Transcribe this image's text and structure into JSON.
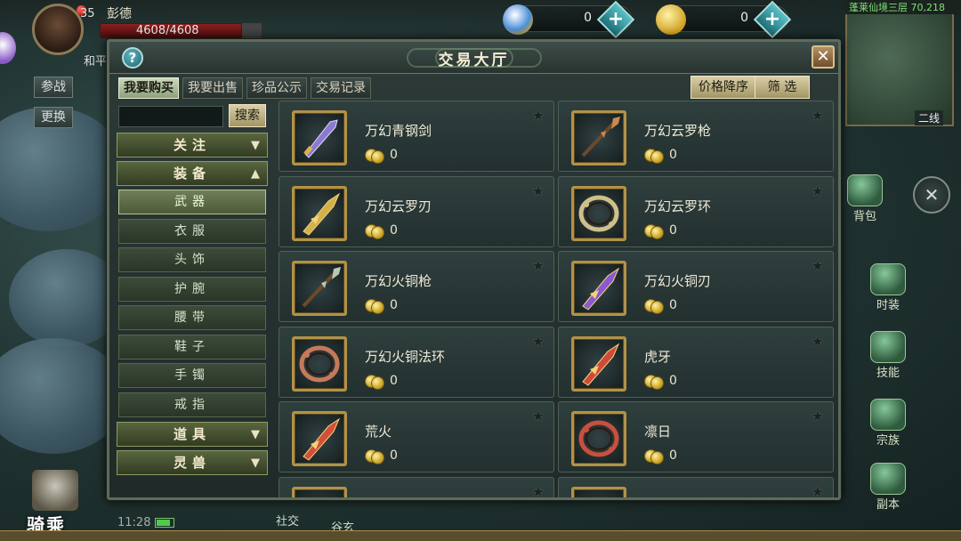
{
  "hud": {
    "level": "35",
    "player_name": "彭德",
    "hp_text": "4608/4608",
    "status_text": "和平",
    "side_buttons": [
      "参战",
      "更换"
    ],
    "currency_a_value": "0",
    "currency_b_value": "0",
    "minimap_location": "蓬莱仙境三层 70,218",
    "minimap_line": "二线",
    "right_menu": [
      "背包",
      "时装",
      "技能",
      "宗族",
      "副本"
    ],
    "mount_label": "骑乘",
    "clock": "11:28",
    "bottom_labels": [
      "社交",
      "谷玄"
    ]
  },
  "dialog": {
    "title": "交易大厅",
    "help_label": "?",
    "close_label": "✕",
    "tabs": [
      "我要购买",
      "我要出售",
      "珍品公示",
      "交易记录"
    ],
    "sort_button": "价格降序",
    "filter_button": "筛 选",
    "search_placeholder": "",
    "search_button": "搜索",
    "categories": [
      {
        "label": "关注",
        "arrow": "▼"
      },
      {
        "label": "装备",
        "arrow": "▲"
      },
      {
        "label": "道具",
        "arrow": "▼"
      },
      {
        "label": "灵兽",
        "arrow": "▼"
      }
    ],
    "subcategories": [
      "武器",
      "衣服",
      "头饰",
      "护腕",
      "腰带",
      "鞋子",
      "手镯",
      "戒指"
    ],
    "items": [
      {
        "name": "万幻青钢剑",
        "price": "0",
        "icon": "sword-icon",
        "color": "#8a7ad0"
      },
      {
        "name": "万幻云罗枪",
        "price": "0",
        "icon": "spear-icon",
        "color": "#c88a52"
      },
      {
        "name": "万幻云罗刃",
        "price": "0",
        "icon": "blade-icon",
        "color": "#d2b04a"
      },
      {
        "name": "万幻云罗环",
        "price": "0",
        "icon": "ring-icon",
        "color": "#cfc08a"
      },
      {
        "name": "万幻火铜枪",
        "price": "0",
        "icon": "spear-icon",
        "color": "#b9c8b4"
      },
      {
        "name": "万幻火铜刃",
        "price": "0",
        "icon": "blade-icon",
        "color": "#8a5ad0"
      },
      {
        "name": "万幻火铜法环",
        "price": "0",
        "icon": "ring-icon",
        "color": "#c47a5a"
      },
      {
        "name": "虎牙",
        "price": "0",
        "icon": "blade-icon",
        "color": "#d04a3a"
      },
      {
        "name": "荒火",
        "price": "0",
        "icon": "blade-icon",
        "color": "#d2503a"
      },
      {
        "name": "凛日",
        "price": "0",
        "icon": "ring-icon",
        "color": "#c8503e"
      }
    ]
  }
}
